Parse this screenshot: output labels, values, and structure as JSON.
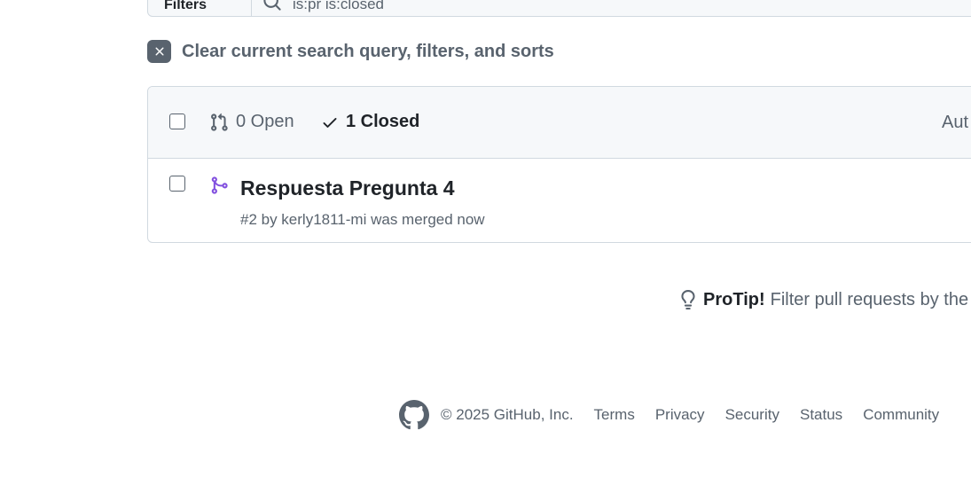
{
  "search": {
    "filters_label": "Filters",
    "query": "is:pr is:closed"
  },
  "clear": {
    "label": "Clear current search query, filters, and sorts"
  },
  "list_header": {
    "open_label": "0 Open",
    "closed_label": "1 Closed",
    "author_label": "Aut"
  },
  "pull_requests": [
    {
      "title": "Respuesta Pregunta 4",
      "meta": "#2 by kerly1811-mi was merged now"
    }
  ],
  "protip": {
    "label": "ProTip!",
    "text": "Filter pull requests by the"
  },
  "footer": {
    "copyright": "© 2025 GitHub, Inc.",
    "links": [
      "Terms",
      "Privacy",
      "Security",
      "Status",
      "Community"
    ]
  },
  "colors": {
    "merged": "#8250df",
    "muted": "#59636e",
    "border": "#d1d9e0"
  }
}
